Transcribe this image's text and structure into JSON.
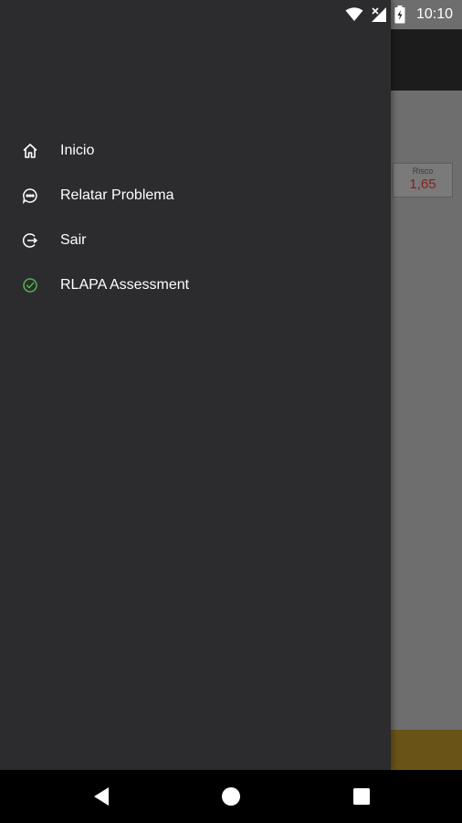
{
  "status_bar": {
    "time": "10:10",
    "icons": [
      "wifi-icon",
      "no-signal-icon",
      "battery-charging-icon"
    ]
  },
  "background_app": {
    "risk_label": "Risco",
    "risk_value": "1,65",
    "colors": {
      "toolbar": "#1c1c1c",
      "scrim": "#6e6e6e",
      "footer": "#6a5316",
      "risk_value": "#8a1f1f"
    }
  },
  "drawer": {
    "background": "#2c2b2d",
    "items": [
      {
        "label": "Inicio",
        "icon": "home-icon"
      },
      {
        "label": "Relatar Problema",
        "icon": "chat-bubble-icon"
      },
      {
        "label": "Sair",
        "icon": "logout-icon"
      },
      {
        "label": "RLAPA Assessment",
        "icon": "check-circle-icon",
        "icon_color": "#4caf50"
      }
    ]
  },
  "nav_bar": {
    "buttons": [
      "back-icon",
      "home-circle-icon",
      "recents-icon"
    ]
  }
}
